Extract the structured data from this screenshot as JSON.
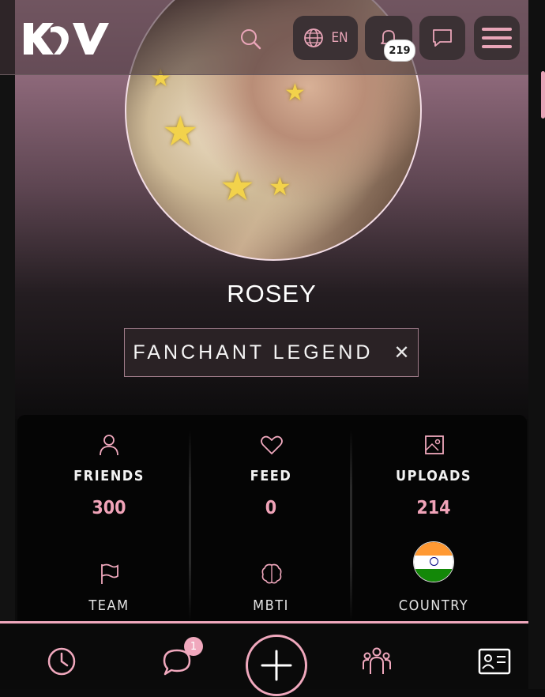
{
  "header": {
    "logo_text": "KV",
    "language": "EN",
    "notifications_count": "219"
  },
  "profile": {
    "username": "ROSEY",
    "title_badge": "FANCHANT LEGEND",
    "remove_symbol": "✕"
  },
  "stats": [
    {
      "label": "FRIENDS",
      "value": "300",
      "icon": "user-icon"
    },
    {
      "label": "FEED",
      "value": "0",
      "icon": "heart-icon"
    },
    {
      "label": "UPLOADS",
      "value": "214",
      "icon": "image-icon"
    },
    {
      "label": "TEAM",
      "icon": "flag-icon"
    },
    {
      "label": "MBTI",
      "icon": "brain-icon"
    },
    {
      "label": "COUNTRY",
      "icon": "india-flag"
    }
  ],
  "bottom_nav": {
    "messages_badge": "1",
    "items": [
      "history-icon",
      "chat-icon",
      "plus-icon",
      "group-icon",
      "id-card-icon"
    ]
  },
  "colors": {
    "accent": "#f0a8bd",
    "value": "#f0a3b8"
  }
}
